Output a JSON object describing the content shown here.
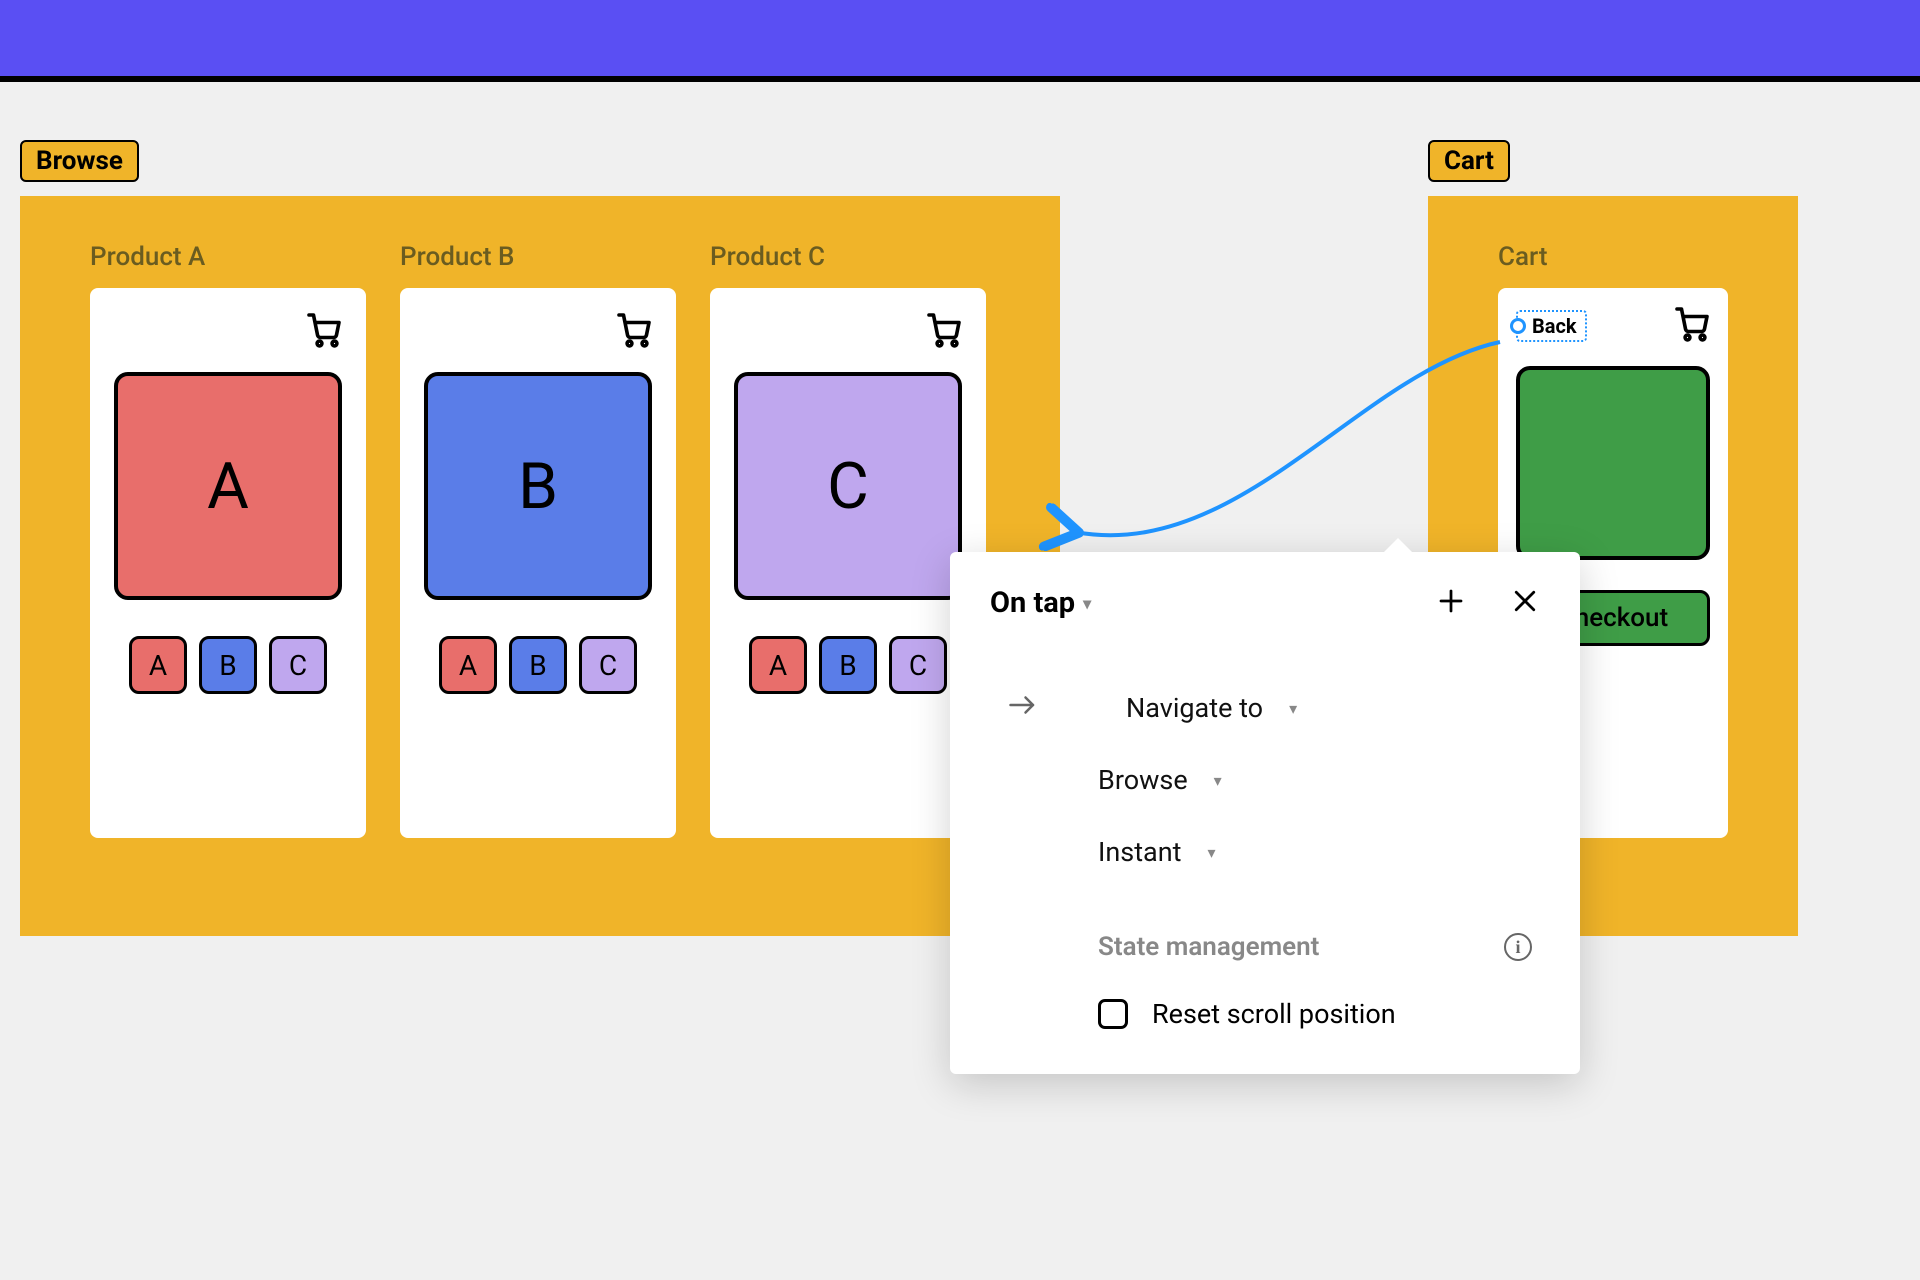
{
  "flows": {
    "browse": {
      "badge": "Browse",
      "frames": [
        {
          "title": "Product A",
          "hero": "A",
          "hero_color": "red"
        },
        {
          "title": "Product B",
          "hero": "B",
          "hero_color": "blue"
        },
        {
          "title": "Product C",
          "hero": "C",
          "hero_color": "purple"
        }
      ],
      "chips": [
        "A",
        "B",
        "C"
      ]
    },
    "cart": {
      "badge": "Cart",
      "frame": {
        "title": "Cart",
        "back_label": "Back",
        "checkout_label": "Checkout",
        "hero_color": "green"
      }
    }
  },
  "panel": {
    "trigger": "On tap",
    "action": "Navigate to",
    "target": "Browse",
    "transition": "Instant",
    "section_label": "State management",
    "checkbox_label": "Reset scroll position",
    "checkbox_checked": false
  },
  "icons": {
    "cart": "cart-icon",
    "plus": "plus-icon",
    "close": "close-icon",
    "info": "info-icon",
    "arrow_right": "arrow-right-icon",
    "chevron_down": "chevron-down-icon"
  },
  "colors": {
    "accent_purple": "#5a4ff3",
    "flow_yellow": "#f0b429",
    "connector_blue": "#1f94ff",
    "red": "#e86e6b",
    "blue": "#5a7de8",
    "lavender": "#bfa7ee",
    "green": "#3f9d47"
  }
}
